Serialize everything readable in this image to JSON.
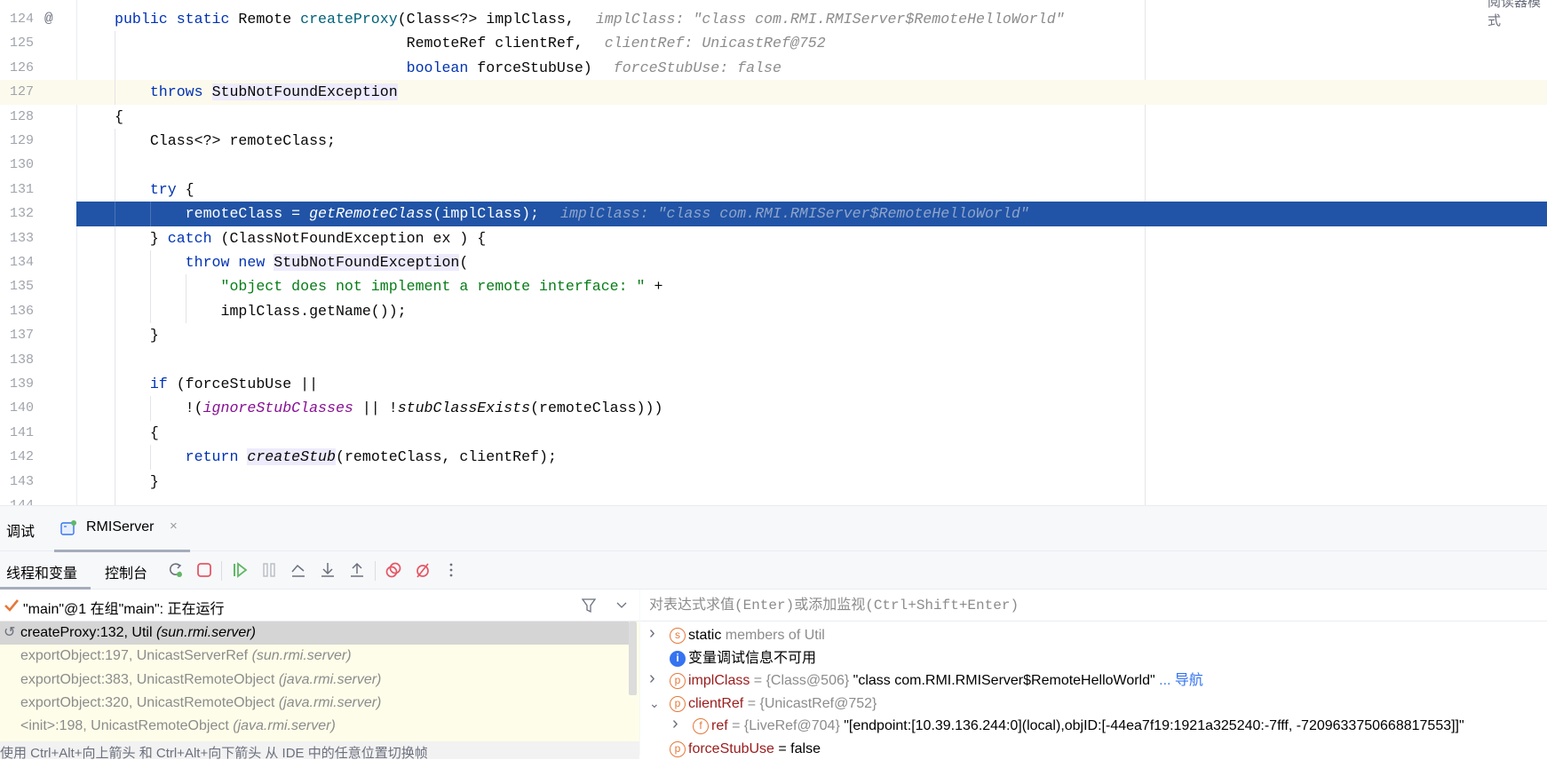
{
  "editor": {
    "reader_mode": "阅读器模式",
    "annotation_icon": "at-sign-icon",
    "caret_line": 127,
    "current_line": 132,
    "lines": [
      {
        "num": "124",
        "tokens": [
          {
            "t": "public static ",
            "c": "kw"
          },
          {
            "t": "Remote ",
            "c": ""
          },
          {
            "t": "createProxy",
            "c": "md"
          },
          {
            "t": "(Class<?> implClass,",
            "c": ""
          },
          {
            "t": "implClass: \"class com.RMI.RMIServer$RemoteHelloWorld\"",
            "c": "hint"
          }
        ]
      },
      {
        "num": "125",
        "tokens": [
          {
            "t": "                                 RemoteRef clientRef,",
            "c": ""
          },
          {
            "t": "clientRef: UnicastRef@752",
            "c": "hint"
          }
        ]
      },
      {
        "num": "126",
        "tokens": [
          {
            "t": "                                 ",
            "c": ""
          },
          {
            "t": "boolean",
            "c": "kw"
          },
          {
            "t": " forceStubUse)",
            "c": ""
          },
          {
            "t": "forceStubUse: false",
            "c": "hint"
          }
        ]
      },
      {
        "num": "127",
        "tokens": [
          {
            "t": "    ",
            "c": ""
          },
          {
            "t": "throws",
            "c": "kw"
          },
          {
            "t": " ",
            "c": ""
          },
          {
            "t": "StubNotFoundException",
            "c": "hl"
          }
        ]
      },
      {
        "num": "128",
        "tokens": [
          {
            "t": "{",
            "c": ""
          }
        ]
      },
      {
        "num": "129",
        "tokens": [
          {
            "t": "    Class<?> remoteClass;",
            "c": ""
          }
        ]
      },
      {
        "num": "130",
        "tokens": []
      },
      {
        "num": "131",
        "tokens": [
          {
            "t": "    ",
            "c": ""
          },
          {
            "t": "try",
            "c": "kw"
          },
          {
            "t": " {",
            "c": ""
          }
        ]
      },
      {
        "num": "132",
        "tokens": [
          {
            "t": "        remoteClass = ",
            "c": ""
          },
          {
            "t": "getRemoteClass",
            "c": "it"
          },
          {
            "t": "(implClass);",
            "c": ""
          },
          {
            "t": "implClass: \"class com.RMI.RMIServer$RemoteHelloWorld\"",
            "c": "hint"
          }
        ]
      },
      {
        "num": "133",
        "tokens": [
          {
            "t": "    } ",
            "c": ""
          },
          {
            "t": "catch",
            "c": "kw"
          },
          {
            "t": " (ClassNotFoundException ex ) {",
            "c": ""
          }
        ]
      },
      {
        "num": "134",
        "tokens": [
          {
            "t": "        ",
            "c": ""
          },
          {
            "t": "throw new",
            "c": "kw"
          },
          {
            "t": " ",
            "c": ""
          },
          {
            "t": "StubNotFoundException",
            "c": "hl"
          },
          {
            "t": "(",
            "c": ""
          }
        ]
      },
      {
        "num": "135",
        "tokens": [
          {
            "t": "            ",
            "c": ""
          },
          {
            "t": "\"object does not implement a remote interface: \"",
            "c": "str"
          },
          {
            "t": " +",
            "c": ""
          }
        ]
      },
      {
        "num": "136",
        "tokens": [
          {
            "t": "            implClass.getName());",
            "c": ""
          }
        ]
      },
      {
        "num": "137",
        "tokens": [
          {
            "t": "    }",
            "c": ""
          }
        ]
      },
      {
        "num": "138",
        "tokens": []
      },
      {
        "num": "139",
        "tokens": [
          {
            "t": "    ",
            "c": ""
          },
          {
            "t": "if",
            "c": "kw"
          },
          {
            "t": " (forceStubUse ||",
            "c": ""
          }
        ]
      },
      {
        "num": "140",
        "tokens": [
          {
            "t": "        !(",
            "c": ""
          },
          {
            "t": "ignoreStubClasses",
            "c": "fld"
          },
          {
            "t": " || !",
            "c": ""
          },
          {
            "t": "stubClassExists",
            "c": "it"
          },
          {
            "t": "(remoteClass)))",
            "c": ""
          }
        ]
      },
      {
        "num": "141",
        "tokens": [
          {
            "t": "    {",
            "c": ""
          }
        ]
      },
      {
        "num": "142",
        "tokens": [
          {
            "t": "        ",
            "c": ""
          },
          {
            "t": "return",
            "c": "kw"
          },
          {
            "t": " ",
            "c": ""
          },
          {
            "t": "createStub",
            "c": "it hl"
          },
          {
            "t": "(remoteClass, clientRef);",
            "c": ""
          }
        ]
      },
      {
        "num": "143",
        "tokens": [
          {
            "t": "    }",
            "c": ""
          }
        ]
      },
      {
        "num": "144",
        "tokens": []
      }
    ]
  },
  "debug": {
    "title": "调试",
    "session_tab": {
      "label": "RMIServer",
      "icon": "application-icon",
      "close": "×"
    },
    "subtabs": [
      "线程和变量",
      "控制台"
    ],
    "toolbar_icons": [
      "rerun-icon",
      "stop-icon",
      "resume-icon",
      "pause-icon",
      "step-over-icon",
      "step-into-icon",
      "step-out-icon",
      "view-breakpoints-icon",
      "mute-breakpoints-icon",
      "more-icon"
    ],
    "thread": {
      "text": "\"main\"@1 在组\"main\": 正在运行",
      "status_icon": "checkmark-icon"
    },
    "frames": [
      {
        "method": "createProxy:132, Util ",
        "pkg": "(sun.rmi.server)",
        "current": true
      },
      {
        "method": "exportObject:197, UnicastServerRef ",
        "pkg": "(sun.rmi.server)"
      },
      {
        "method": "exportObject:383, UnicastRemoteObject ",
        "pkg": "(java.rmi.server)"
      },
      {
        "method": "exportObject:320, UnicastRemoteObject ",
        "pkg": "(java.rmi.server)"
      },
      {
        "method": "<init>:198, UnicastRemoteObject ",
        "pkg": "(java.rmi.server)"
      }
    ],
    "hint": "使用 Ctrl+Alt+向上箭头 和 Ctrl+Alt+向下箭头 从 IDE 中的任意位置切换帧",
    "eval_placeholder": "对表达式求值(Enter)或添加监视(Ctrl+Shift+Enter)",
    "variables": [
      {
        "chevron": "right",
        "icon": "s",
        "name": "static",
        "gray": " members of Util",
        "value": "",
        "link": ""
      },
      {
        "chevron": "",
        "icon": "i",
        "name": "",
        "gray": "",
        "value": "变量调试信息不可用",
        "link": ""
      },
      {
        "chevron": "right",
        "icon": "p",
        "name": "implClass",
        "gray": " = {Class@506} ",
        "value": "\"class com.RMI.RMIServer$RemoteHelloWorld\"",
        "link": " ... 导航"
      },
      {
        "chevron": "down",
        "icon": "p",
        "name": "clientRef",
        "gray": " = {UnicastRef@752}",
        "value": "",
        "link": ""
      },
      {
        "chevron": "right",
        "icon": "f",
        "name": "ref",
        "gray": " = {LiveRef@704} ",
        "value": "\"[endpoint:[10.39.136.244:0](local),objID:[-44ea7f19:1921a325240:-7fff, -7209633750668817553]]\"",
        "link": "",
        "nested": true
      },
      {
        "chevron": "",
        "icon": "p",
        "name": "forceStubUse",
        "gray": "",
        "value": " = false",
        "link": ""
      }
    ]
  }
}
